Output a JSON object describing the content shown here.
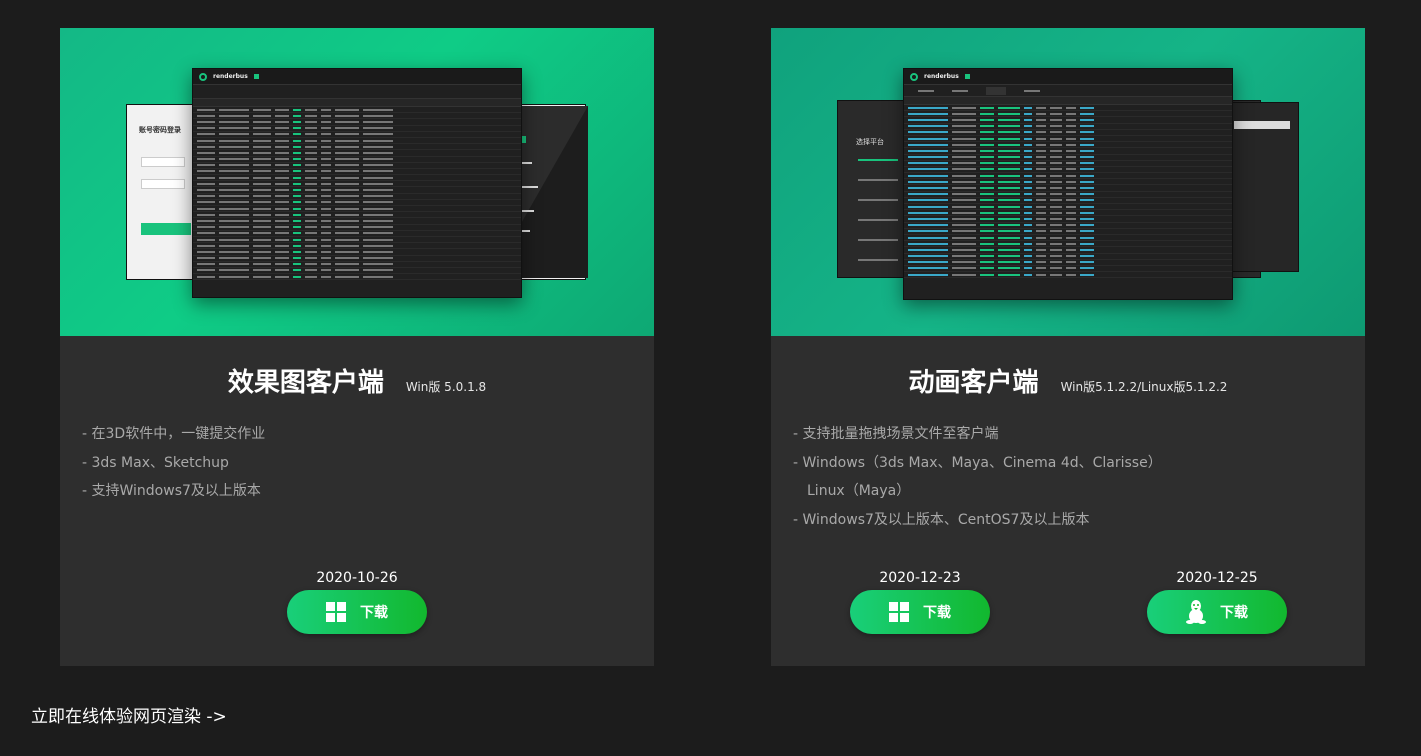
{
  "cards": [
    {
      "title": "效果图客户端",
      "version": "Win版 5.0.1.8",
      "features": [
        "- 在3D软件中，一键提交作业",
        "- 3ds Max、Sketchup",
        "- 支持Windows7及以上版本"
      ],
      "downloads": [
        {
          "date": "2020-10-26",
          "label": "下载",
          "icon": "windows-icon"
        }
      ]
    },
    {
      "title": "动画客户端",
      "version": "Win版5.1.2.2/Linux版5.1.2.2",
      "features": [
        "- 支持批量拖拽场景文件至客户端",
        "- Windows（3ds Max、Maya、Cinema 4d、Clarisse）",
        "Linux（Maya）",
        "- Windows7及以上版本、CentOS7及以上版本"
      ],
      "downloads": [
        {
          "date": "2020-12-23",
          "label": "下载",
          "icon": "windows-icon"
        },
        {
          "date": "2020-12-25",
          "label": "下载",
          "icon": "linux-icon"
        }
      ]
    }
  ],
  "footer_link": "立即在线体验网页渲染 ->",
  "mockup": {
    "brand": "renderbus",
    "login_title": "账号密码登录",
    "platform_title": "选择平台"
  },
  "colors": {
    "page_bg": "#1c1c1c",
    "card_bg": "#2e2e2e",
    "accent_green": "#19c37d",
    "button_gradient_start": "#19cf7a",
    "button_gradient_end": "#12b82e"
  }
}
